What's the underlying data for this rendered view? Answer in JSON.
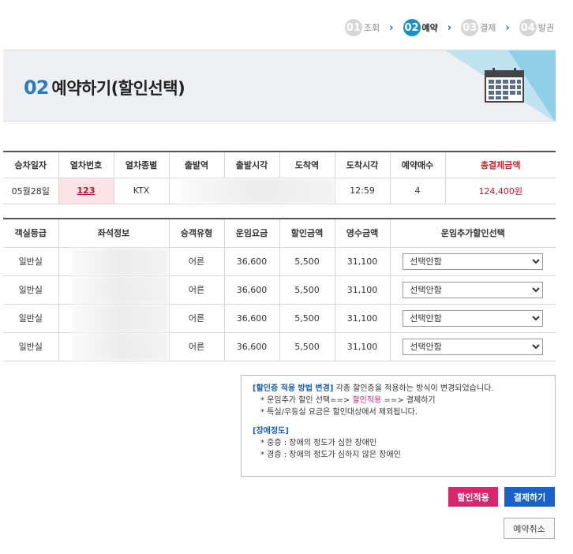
{
  "steps": [
    {
      "num": "01",
      "label": "조회"
    },
    {
      "num": "02",
      "label": "예약"
    },
    {
      "num": "03",
      "label": "결제"
    },
    {
      "num": "04",
      "label": "발권"
    }
  ],
  "banner": {
    "num": "02",
    "title": "예약하기(할인선택)"
  },
  "trip_table": {
    "headers": [
      "승차일자",
      "열차번호",
      "열차종별",
      "출발역",
      "출발시각",
      "도착역",
      "도착시각",
      "예약매수",
      "총결제금액"
    ],
    "row": {
      "date": "05월28일",
      "train_no": "123",
      "train_type": "KTX",
      "arrive_time": "12:59",
      "count": "4",
      "total": "124,400원"
    }
  },
  "seat_table": {
    "headers": [
      "객실등급",
      "좌석정보",
      "승객유형",
      "운임요금",
      "할인금액",
      "영수금액",
      "운임추가할인선택"
    ],
    "rows": [
      {
        "class": "일반실",
        "type": "어른",
        "fare": "36,600",
        "discount": "5,500",
        "paid": "31,100",
        "option": "선택안함"
      },
      {
        "class": "일반실",
        "type": "어른",
        "fare": "36,600",
        "discount": "5,500",
        "paid": "31,100",
        "option": "선택안함"
      },
      {
        "class": "일반실",
        "type": "어른",
        "fare": "36,600",
        "discount": "5,500",
        "paid": "31,100",
        "option": "선택안함"
      },
      {
        "class": "일반실",
        "type": "어른",
        "fare": "36,600",
        "discount": "5,500",
        "paid": "31,100",
        "option": "선택안함"
      }
    ]
  },
  "info": {
    "head1": "[할인증 적용 방법 변경]",
    "desc1": " 각종 할인증을 적용하는 방식이 변경되었습니다.",
    "line1a": "* 운임추가 할인 선택==> ",
    "line1b": "할인적용",
    "line1c": " ==> 결제하기",
    "line2": "* 특실/우등실 요금은 할인대상에서 제외됩니다.",
    "head2": "[장애정도]",
    "line3": "* 중증 : 장애의 정도가 심한 장애인",
    "line4": "* 경증 : 장애의 정도가 심하지 않은 장애인"
  },
  "buttons": {
    "discount": "할인적용",
    "pay": "결제하기",
    "cancel": "예약취소"
  }
}
